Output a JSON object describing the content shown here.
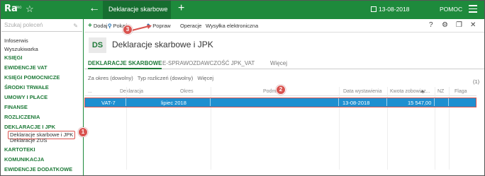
{
  "app": {
    "logo": "Ra",
    "logo_sup": "PRO"
  },
  "topbar": {
    "tab_title": "Deklaracje skarbowe",
    "date": "13-08-2018",
    "help": "POMOC"
  },
  "sidebar": {
    "search_placeholder": "Szukaj poleceń",
    "items": [
      {
        "label": "Infoserwis",
        "kind": "item"
      },
      {
        "label": "Wyszukiwarka",
        "kind": "item"
      },
      {
        "label": "KSIĘGI",
        "kind": "cat"
      },
      {
        "label": "EWIDENCJE VAT",
        "kind": "cat"
      },
      {
        "label": "KSIĘGI POMOCNICZE",
        "kind": "cat"
      },
      {
        "label": "ŚRODKI TRWAŁE",
        "kind": "cat"
      },
      {
        "label": "UMOWY I PŁACE",
        "kind": "cat"
      },
      {
        "label": "FINANSE",
        "kind": "cat"
      },
      {
        "label": "ROZLICZENIA",
        "kind": "cat"
      },
      {
        "label": "DEKLARACJE I JPK",
        "kind": "cat"
      },
      {
        "label": "Deklaracje skarbowe i JPK",
        "kind": "sub"
      },
      {
        "label": "Deklaracje ZUS",
        "kind": "sub"
      },
      {
        "label": "KARTOTEKI",
        "kind": "cat"
      },
      {
        "label": "KOMUNIKACJA",
        "kind": "cat"
      },
      {
        "label": "EWIDENCJE DODATKOWE",
        "kind": "cat"
      }
    ]
  },
  "toolbar": {
    "add": "Dodaj",
    "show": "Pokaż",
    "edit": "Popraw",
    "operations": "Operacje",
    "send": "Wysyłka elektroniczna",
    "help_q": "?"
  },
  "header": {
    "badge": "DS",
    "title": "Deklaracje skarbowe i JPK"
  },
  "tabs": [
    "DEKLARACJE SKARBOWE",
    "E-SPRAWOZDAWCZOŚĆ JPK_VAT",
    "Więcej"
  ],
  "filters": {
    "period": "Za okres (dowolny)",
    "type": "Typ rozliczeń (dowolny)",
    "more": "Więcej",
    "count": "(1)"
  },
  "grid": {
    "columns": [
      "...",
      "Deklaracja",
      "Okres",
      "Podmiot",
      "Data wystawienia",
      "Kwota zobowiąz...",
      "NZ",
      "Flaga"
    ],
    "rows": [
      {
        "deklaracja": "VAT-7",
        "okres": "lipiec 2018",
        "podmiot": "",
        "data": "13-08-2018",
        "kwota": "15 547,00",
        "nz": "",
        "flaga": ""
      }
    ]
  },
  "callouts": [
    "1",
    "2",
    "3"
  ],
  "colors": {
    "brand_green": "#1e8a3c",
    "selection_blue": "#1e8fd0",
    "callout_red": "#d9534f"
  }
}
